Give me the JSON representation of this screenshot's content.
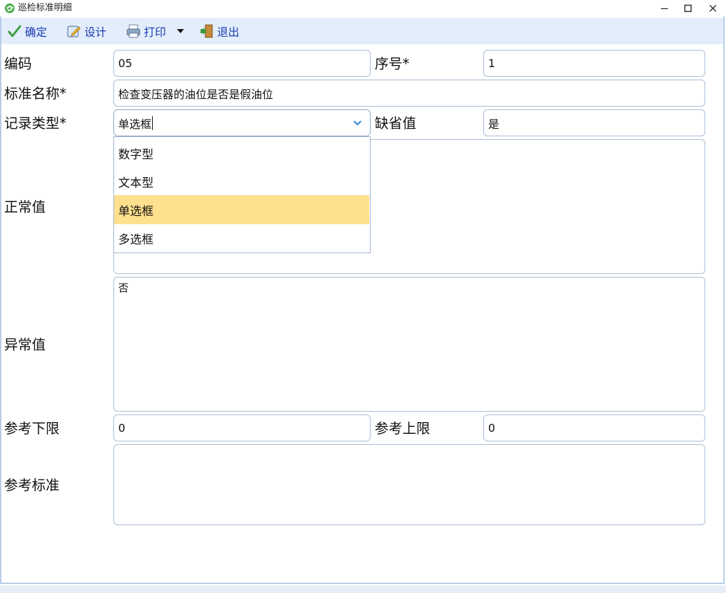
{
  "window": {
    "title": "巡检标准明细"
  },
  "toolbar": {
    "ok_label": "确定",
    "design_label": "设计",
    "print_label": "打印",
    "exit_label": "退出"
  },
  "form": {
    "code": {
      "label": "编码",
      "value": "05"
    },
    "seq": {
      "label": "序号*",
      "value": "1"
    },
    "std_name": {
      "label": "标准名称*",
      "value": "检查变压器的油位是否是假油位"
    },
    "record_type": {
      "label": "记录类型*",
      "value": "单选框"
    },
    "default": {
      "label": "缺省值",
      "value": "是"
    },
    "normal": {
      "label": "正常值",
      "value": ""
    },
    "abnormal": {
      "label": "异常值",
      "value": "否"
    },
    "ref_lower": {
      "label": "参考下限",
      "value": "0"
    },
    "ref_upper": {
      "label": "参考上限",
      "value": "0"
    },
    "ref_std": {
      "label": "参考标准",
      "value": ""
    }
  },
  "dropdown": {
    "options": [
      "数字型",
      "文本型",
      "单选框",
      "多选框"
    ],
    "selected": "单选框"
  },
  "colors": {
    "toolbar_bg": "#e3edfb",
    "toolbar_text": "#1a3bb3",
    "border": "#a9bcd6",
    "selected_bg": "#ffe08e"
  }
}
